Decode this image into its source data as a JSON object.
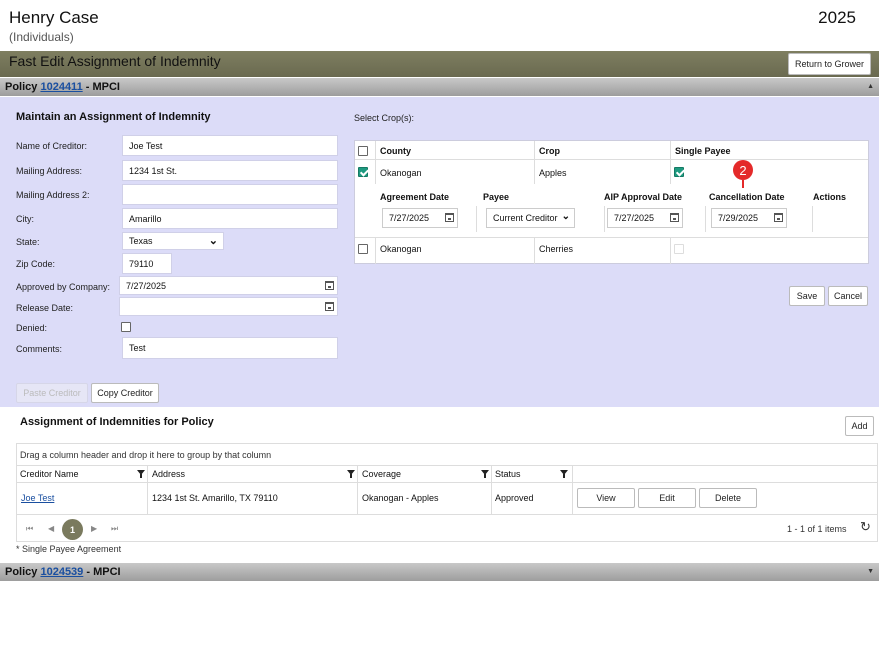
{
  "header": {
    "name": "Henry Case",
    "subtitle": "(Individuals)",
    "year": "2025",
    "section_title": "Fast Edit Assignment of Indemnity",
    "return_label": "Return to Grower"
  },
  "policy1": {
    "prefix": "Policy",
    "number": "1024411",
    "suffix": "- MPCI"
  },
  "policy2": {
    "prefix": "Policy",
    "number": "1024539",
    "suffix": "- MPCI"
  },
  "form": {
    "title": "Maintain an Assignment of Indemnity",
    "name_label": "Name of Creditor:",
    "name_value": "Joe Test",
    "addr_label": "Mailing Address:",
    "addr_value": "1234 1st St.",
    "addr2_label": "Mailing Address 2:",
    "addr2_value": "",
    "city_label": "City:",
    "city_value": "Amarillo",
    "state_label": "State:",
    "state_value": "Texas",
    "zip_label": "Zip Code:",
    "zip_value": "79110",
    "approved_label": "Approved by Company:",
    "approved_value": "7/27/2025",
    "release_label": "Release Date:",
    "release_value": "",
    "denied_label": "Denied:",
    "comments_label": "Comments:",
    "comments_value": "Test",
    "paste_label": "Paste Creditor",
    "copy_label": "Copy Creditor"
  },
  "crops": {
    "select_label": "Select Crop(s):",
    "headers": {
      "county": "County",
      "crop": "Crop",
      "single": "Single Payee"
    },
    "row1": {
      "county": "Okanogan",
      "crop": "Apples"
    },
    "row2": {
      "county": "Okanogan",
      "crop": "Cherries"
    },
    "sub_headers": {
      "agreement": "Agreement Date",
      "payee": "Payee",
      "aip": "AIP Approval Date",
      "cancel": "Cancellation Date",
      "actions": "Actions"
    },
    "sub_values": {
      "agreement": "7/27/2025",
      "payee": "Current Creditor",
      "aip": "7/27/2025",
      "cancel": "7/29/2025"
    },
    "save_label": "Save",
    "cancel_label": "Cancel",
    "badge": "2"
  },
  "grid": {
    "title": "Assignment of Indemnities for Policy",
    "add_label": "Add",
    "group_hint": "Drag a column header and drop it here to group by that column",
    "columns": {
      "creditor": "Creditor Name",
      "address": "Address",
      "coverage": "Coverage",
      "status": "Status"
    },
    "row": {
      "creditor": "Joe Test",
      "address": "1234 1st St. Amarillo, TX 79110",
      "coverage": "Okanogan - Apples",
      "status": "Approved"
    },
    "view_label": "View",
    "edit_label": "Edit",
    "delete_label": "Delete",
    "page": "1",
    "items_text": "1 - 1 of 1 items",
    "footnote": "* Single Payee Agreement"
  },
  "colors": {
    "accent": "#1e9a80",
    "badge": "#e42a2a",
    "panel": "#dcdcf8",
    "header_bar": "#767658"
  }
}
